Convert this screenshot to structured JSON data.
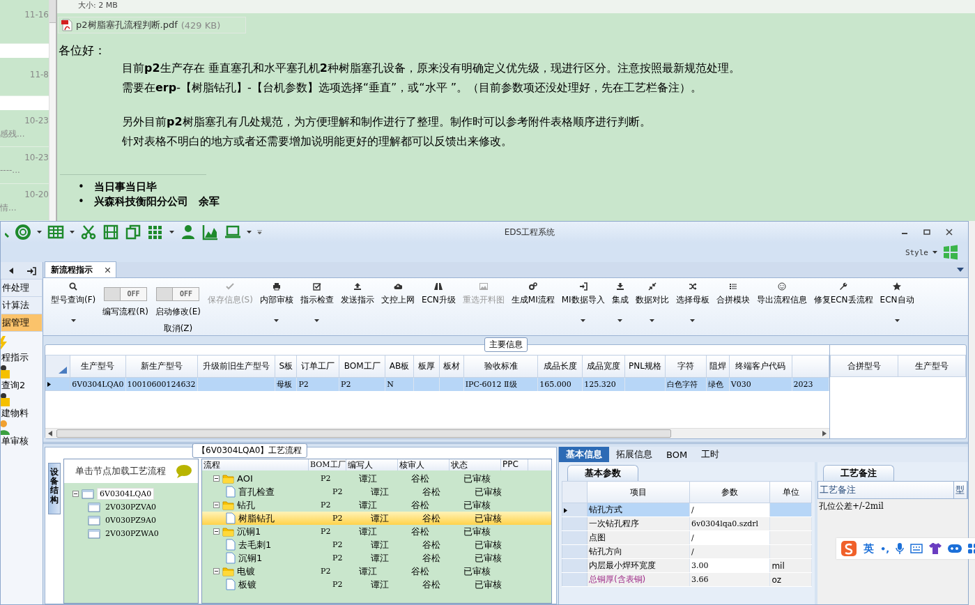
{
  "email": {
    "list_items": [
      {
        "date": "11-16"
      },
      {
        "date": "11-8"
      },
      {
        "date": "10-23",
        "preview": "感残..."
      },
      {
        "date": "10-23",
        "preview": "----..."
      },
      {
        "date": "10-20",
        "preview": "情..."
      }
    ],
    "size_line": "大小: 2 MB",
    "attachment": {
      "name": "p2树脂塞孔流程判断.pdf",
      "size": "(429 KB)"
    },
    "greeting": "各位好：",
    "paragraphs": [
      [
        "目前**p2**生产存在 垂直塞孔和水平塞孔机**2**种树脂塞孔设备，原来没有明确定义优先级，现进行区分。注意按照最新规范处理。",
        "需要在**erp**-【树脂钻孔】-【台机参数】选项选择“垂直”，或“水平 ”。（目前参数项还没处理好，先在工艺栏备注）。"
      ],
      [
        "另外目前**p2**树脂塞孔有几处规范，为方便理解和制作进行了整理。制作时可以参考附件表格顺序进行判断。",
        "针对表格不明白的地方或者还需要增加说明能更好的理解都可以反馈出来修改。"
      ]
    ],
    "signature": [
      {
        "bullet": "•",
        "text": "当日事当日毕"
      },
      {
        "bullet": "•",
        "text": "兴森科技衡阳分公司　余军"
      }
    ]
  },
  "window": {
    "title": "EDS工程系统",
    "style_menu": "Style"
  },
  "nav": {
    "items": [
      {
        "label": "件处理",
        "selected": false
      },
      {
        "label": "计算法",
        "selected": false
      },
      {
        "label": "据管理",
        "selected": true
      }
    ],
    "launchers": [
      {
        "label": "程指示",
        "kind": "flash"
      },
      {
        "label": "查询2",
        "kind": "folder"
      },
      {
        "label": "建物料",
        "kind": "folder"
      },
      {
        "label": "单审核",
        "kind": "user"
      }
    ]
  },
  "doc_tab": {
    "label": "新流程指示",
    "selected": true
  },
  "ribbon": [
    {
      "kind": "button",
      "label": "型号查询(F)",
      "menu": true,
      "disabled": false
    },
    {
      "kind": "toggle",
      "label": "编写流程(R)",
      "switch": "OFF",
      "on": false
    },
    {
      "kind": "toggle",
      "label": "启动修改(E)",
      "sublabel": "取消(Z)",
      "switch": "OFF",
      "on": false
    },
    {
      "kind": "button",
      "label": "保存信息(S)",
      "menu": false,
      "disabled": true
    },
    {
      "kind": "button",
      "label": "内部审核",
      "menu": true,
      "disabled": false
    },
    {
      "kind": "button",
      "label": "指示检查",
      "menu": true,
      "disabled": false
    },
    {
      "kind": "button",
      "label": "发送指示",
      "menu": false,
      "disabled": false
    },
    {
      "kind": "button",
      "label": "文控上网",
      "menu": false,
      "disabled": false
    },
    {
      "kind": "button",
      "label": "ECN升级",
      "menu": false,
      "disabled": false
    },
    {
      "kind": "button",
      "label": "重选开料图",
      "menu": false,
      "disabled": true
    },
    {
      "kind": "button",
      "label": "生成MI流程",
      "menu": false,
      "disabled": false
    },
    {
      "kind": "button",
      "label": "MI数据导入",
      "menu": true,
      "disabled": false
    },
    {
      "kind": "button",
      "label": "集成",
      "menu": true,
      "disabled": false
    },
    {
      "kind": "button",
      "label": "数据对比",
      "menu": true,
      "disabled": false
    },
    {
      "kind": "button",
      "label": "选择母板",
      "menu": true,
      "disabled": false
    },
    {
      "kind": "button",
      "label": "合拼模块",
      "menu": false,
      "disabled": false
    },
    {
      "kind": "button",
      "label": "导出流程信息",
      "menu": false,
      "disabled": false
    },
    {
      "kind": "button",
      "label": "修复ECN丢流程",
      "menu": false,
      "disabled": false
    },
    {
      "kind": "button",
      "label": "ECN自动",
      "menu": true,
      "disabled": false
    }
  ],
  "main_info": {
    "title": "主要信息",
    "columns": [
      "生产型号",
      "新生产型号",
      "升级前旧生产型号",
      "S板",
      "订单工厂",
      "BOM工厂",
      "AB板",
      "板厚",
      "板材",
      "验收标准",
      "成品长度",
      "成品宽度",
      "PNL规格",
      "字符",
      "阻焊",
      "终端客户代码",
      null
    ],
    "rows": [
      {
        "selected": true,
        "cells": [
          "6V0304LQA0",
          "10010600124632",
          null,
          "母板",
          "P2",
          "P2",
          "N",
          null,
          null,
          "IPC-6012 Ⅱ级",
          "165.000",
          "125.320",
          null,
          "白色字符",
          "绿色",
          "V030",
          "2023"
        ]
      }
    ],
    "side_columns": [
      "合拼型号",
      "生产型号"
    ]
  },
  "flow": {
    "title": "【6V0304LQA0】工艺流程",
    "side_tab": "设备结构",
    "tree_header": "单击节点加载工艺流程",
    "tree": [
      {
        "label": "6V0304LQA0",
        "selected": true,
        "children": [
          {
            "label": "2V030PZVA0",
            "selected": false
          },
          {
            "label": "0V030PZ9A0",
            "selected": false
          },
          {
            "label": "2V030PZWA0",
            "selected": false
          }
        ]
      }
    ],
    "columns": [
      "流程",
      "BOM工厂",
      "编写人",
      "核审人",
      "状态",
      "PPC"
    ],
    "rows": [
      {
        "kind": "folder",
        "name": "AOI",
        "bom": "P2",
        "writer": "谭江",
        "reviewer": "谷松",
        "status": "已审核",
        "selected": false,
        "expanded": true,
        "children": [
          {
            "kind": "doc",
            "name": "盲孔检查",
            "bom": "P2",
            "writer": "谭江",
            "reviewer": "谷松",
            "status": "已审核",
            "selected": false
          }
        ]
      },
      {
        "kind": "folder",
        "name": "钻孔",
        "bom": "P2",
        "writer": "谭江",
        "reviewer": "谷松",
        "status": "已审核",
        "selected": false,
        "expanded": true,
        "children": [
          {
            "kind": "doc",
            "name": "树脂钻孔",
            "bom": "P2",
            "writer": "谭江",
            "reviewer": "谷松",
            "status": "已审核",
            "selected": true
          }
        ]
      },
      {
        "kind": "folder",
        "name": "沉铜1",
        "bom": "P2",
        "writer": "谭江",
        "reviewer": "谷松",
        "status": "已审核",
        "selected": false,
        "expanded": true,
        "children": [
          {
            "kind": "doc",
            "name": "去毛刺1",
            "bom": "P2",
            "writer": "谭江",
            "reviewer": "谷松",
            "status": "已审核",
            "selected": false
          },
          {
            "kind": "doc",
            "name": "沉铜1",
            "bom": "P2",
            "writer": "谭江",
            "reviewer": "谷松",
            "status": "已审核",
            "selected": false
          }
        ]
      },
      {
        "kind": "folder",
        "name": "电镀",
        "bom": "P2",
        "writer": "谭江",
        "reviewer": "谷松",
        "status": "已审核",
        "selected": false,
        "expanded": true,
        "children": [
          {
            "kind": "doc",
            "name": "板镀",
            "bom": "P2",
            "writer": "谭江",
            "reviewer": "谷松",
            "status": "已审核",
            "selected": false
          }
        ]
      }
    ]
  },
  "detail": {
    "tabs": [
      {
        "label": "基本信息",
        "selected": true
      },
      {
        "label": "拓展信息",
        "selected": false
      },
      {
        "label": "BOM",
        "selected": false
      },
      {
        "label": "工时",
        "selected": false
      }
    ],
    "subtab": "基本参数",
    "columns": [
      "项目",
      "参数",
      "单位"
    ],
    "rows": [
      {
        "item": "钻孔方式",
        "value": "/",
        "selected": true,
        "highlight": false
      },
      {
        "item": "一次钻孔程序",
        "value": "6v0304lqa0.szdrl",
        "selected": false,
        "highlight": false
      },
      {
        "item": "点图",
        "value": "/",
        "selected": false,
        "highlight": false
      },
      {
        "item": "钻孔方向",
        "value": "/",
        "selected": false,
        "highlight": false
      },
      {
        "item": "内层最小焊环宽度",
        "value": "3.00",
        "unit": "mil",
        "selected": false,
        "highlight": false
      },
      {
        "item": "总铜厚(含表铜)",
        "value": "3.66",
        "unit": "oz",
        "selected": false,
        "highlight": true
      }
    ]
  },
  "notes": {
    "tab": "工艺备注",
    "columns": [
      "工艺备注",
      "型"
    ],
    "rows": [
      "孔位公差+/-2mil"
    ]
  },
  "ime": {
    "mode": "英",
    "punct": "•,"
  }
}
